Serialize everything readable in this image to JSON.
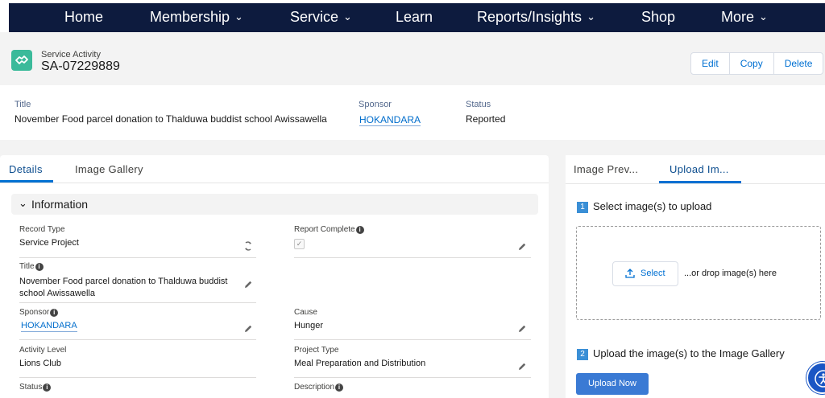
{
  "nav": {
    "items": [
      {
        "label": "Home",
        "dropdown": false
      },
      {
        "label": "Membership",
        "dropdown": true
      },
      {
        "label": "Service",
        "dropdown": true
      },
      {
        "label": "Learn",
        "dropdown": false
      },
      {
        "label": "Reports/Insights",
        "dropdown": true
      },
      {
        "label": "Shop",
        "dropdown": false
      },
      {
        "label": "More",
        "dropdown": true
      }
    ]
  },
  "record": {
    "type_label": "Service Activity",
    "name": "SA-07229889",
    "icon": "handshake-icon",
    "actions": {
      "edit": "Edit",
      "copy": "Copy",
      "delete": "Delete"
    }
  },
  "highlights": {
    "title_label": "Title",
    "title_value": "November Food parcel donation to Thalduwa buddist school Awissawella",
    "sponsor_label": "Sponsor",
    "sponsor_value": "HOKANDARA",
    "status_label": "Status",
    "status_value": "Reported"
  },
  "left_tabs": {
    "details": "Details",
    "image_gallery": "Image Gallery"
  },
  "section": {
    "title": "Information"
  },
  "fields": {
    "record_type": {
      "label": "Record Type",
      "value": "Service Project"
    },
    "report_complete": {
      "label": "Report Complete",
      "checked": true
    },
    "title": {
      "label": "Title",
      "value_line1": "November Food parcel donation to Thalduwa buddist",
      "value_line2": "school Awissawella"
    },
    "sponsor": {
      "label": "Sponsor",
      "value": "HOKANDARA"
    },
    "cause": {
      "label": "Cause",
      "value": "Hunger"
    },
    "activity_level": {
      "label": "Activity Level",
      "value": "Lions Club"
    },
    "project_type": {
      "label": "Project Type",
      "value": "Meal Preparation and Distribution"
    },
    "status": {
      "label": "Status"
    },
    "description": {
      "label": "Description"
    }
  },
  "right_tabs": {
    "image_preview": "Image Prev...",
    "upload_images": "Upload Im..."
  },
  "upload": {
    "step1_num": "1",
    "step1_text": "Select image(s) to upload",
    "select_label": "Select",
    "drop_text": "...or drop image(s) here",
    "step2_num": "2",
    "step2_text": "Upload the image(s) to the Image Gallery",
    "upload_button": "Upload Now"
  },
  "colors": {
    "nav_bg": "#0d1b3e",
    "accent": "#0070d2",
    "record_icon": "#3bba9a"
  }
}
